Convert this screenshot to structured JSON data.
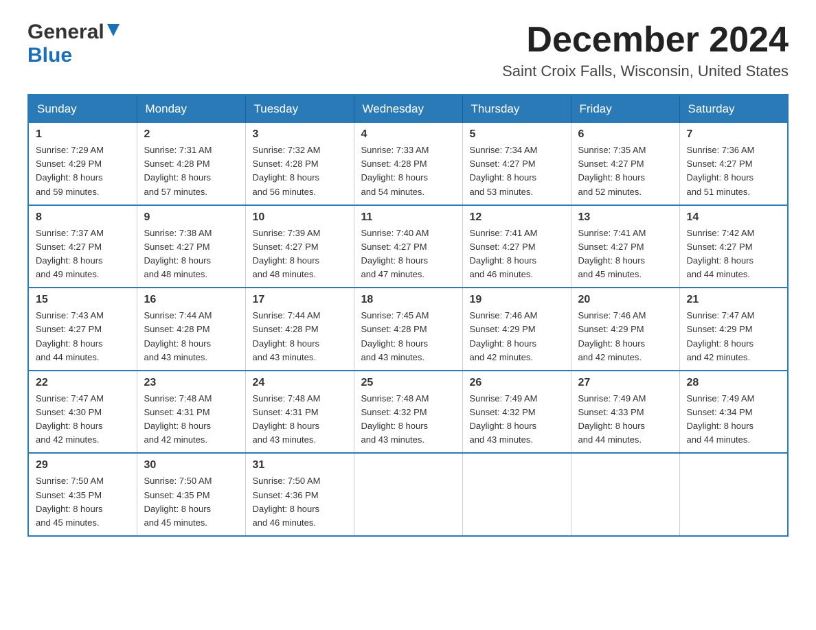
{
  "logo": {
    "general": "General",
    "blue": "Blue"
  },
  "title": {
    "month_year": "December 2024",
    "location": "Saint Croix Falls, Wisconsin, United States"
  },
  "header_days": [
    "Sunday",
    "Monday",
    "Tuesday",
    "Wednesday",
    "Thursday",
    "Friday",
    "Saturday"
  ],
  "weeks": [
    [
      {
        "day": "1",
        "sunrise": "Sunrise: 7:29 AM",
        "sunset": "Sunset: 4:29 PM",
        "daylight": "Daylight: 8 hours",
        "daylight2": "and 59 minutes."
      },
      {
        "day": "2",
        "sunrise": "Sunrise: 7:31 AM",
        "sunset": "Sunset: 4:28 PM",
        "daylight": "Daylight: 8 hours",
        "daylight2": "and 57 minutes."
      },
      {
        "day": "3",
        "sunrise": "Sunrise: 7:32 AM",
        "sunset": "Sunset: 4:28 PM",
        "daylight": "Daylight: 8 hours",
        "daylight2": "and 56 minutes."
      },
      {
        "day": "4",
        "sunrise": "Sunrise: 7:33 AM",
        "sunset": "Sunset: 4:28 PM",
        "daylight": "Daylight: 8 hours",
        "daylight2": "and 54 minutes."
      },
      {
        "day": "5",
        "sunrise": "Sunrise: 7:34 AM",
        "sunset": "Sunset: 4:27 PM",
        "daylight": "Daylight: 8 hours",
        "daylight2": "and 53 minutes."
      },
      {
        "day": "6",
        "sunrise": "Sunrise: 7:35 AM",
        "sunset": "Sunset: 4:27 PM",
        "daylight": "Daylight: 8 hours",
        "daylight2": "and 52 minutes."
      },
      {
        "day": "7",
        "sunrise": "Sunrise: 7:36 AM",
        "sunset": "Sunset: 4:27 PM",
        "daylight": "Daylight: 8 hours",
        "daylight2": "and 51 minutes."
      }
    ],
    [
      {
        "day": "8",
        "sunrise": "Sunrise: 7:37 AM",
        "sunset": "Sunset: 4:27 PM",
        "daylight": "Daylight: 8 hours",
        "daylight2": "and 49 minutes."
      },
      {
        "day": "9",
        "sunrise": "Sunrise: 7:38 AM",
        "sunset": "Sunset: 4:27 PM",
        "daylight": "Daylight: 8 hours",
        "daylight2": "and 48 minutes."
      },
      {
        "day": "10",
        "sunrise": "Sunrise: 7:39 AM",
        "sunset": "Sunset: 4:27 PM",
        "daylight": "Daylight: 8 hours",
        "daylight2": "and 48 minutes."
      },
      {
        "day": "11",
        "sunrise": "Sunrise: 7:40 AM",
        "sunset": "Sunset: 4:27 PM",
        "daylight": "Daylight: 8 hours",
        "daylight2": "and 47 minutes."
      },
      {
        "day": "12",
        "sunrise": "Sunrise: 7:41 AM",
        "sunset": "Sunset: 4:27 PM",
        "daylight": "Daylight: 8 hours",
        "daylight2": "and 46 minutes."
      },
      {
        "day": "13",
        "sunrise": "Sunrise: 7:41 AM",
        "sunset": "Sunset: 4:27 PM",
        "daylight": "Daylight: 8 hours",
        "daylight2": "and 45 minutes."
      },
      {
        "day": "14",
        "sunrise": "Sunrise: 7:42 AM",
        "sunset": "Sunset: 4:27 PM",
        "daylight": "Daylight: 8 hours",
        "daylight2": "and 44 minutes."
      }
    ],
    [
      {
        "day": "15",
        "sunrise": "Sunrise: 7:43 AM",
        "sunset": "Sunset: 4:27 PM",
        "daylight": "Daylight: 8 hours",
        "daylight2": "and 44 minutes."
      },
      {
        "day": "16",
        "sunrise": "Sunrise: 7:44 AM",
        "sunset": "Sunset: 4:28 PM",
        "daylight": "Daylight: 8 hours",
        "daylight2": "and 43 minutes."
      },
      {
        "day": "17",
        "sunrise": "Sunrise: 7:44 AM",
        "sunset": "Sunset: 4:28 PM",
        "daylight": "Daylight: 8 hours",
        "daylight2": "and 43 minutes."
      },
      {
        "day": "18",
        "sunrise": "Sunrise: 7:45 AM",
        "sunset": "Sunset: 4:28 PM",
        "daylight": "Daylight: 8 hours",
        "daylight2": "and 43 minutes."
      },
      {
        "day": "19",
        "sunrise": "Sunrise: 7:46 AM",
        "sunset": "Sunset: 4:29 PM",
        "daylight": "Daylight: 8 hours",
        "daylight2": "and 42 minutes."
      },
      {
        "day": "20",
        "sunrise": "Sunrise: 7:46 AM",
        "sunset": "Sunset: 4:29 PM",
        "daylight": "Daylight: 8 hours",
        "daylight2": "and 42 minutes."
      },
      {
        "day": "21",
        "sunrise": "Sunrise: 7:47 AM",
        "sunset": "Sunset: 4:29 PM",
        "daylight": "Daylight: 8 hours",
        "daylight2": "and 42 minutes."
      }
    ],
    [
      {
        "day": "22",
        "sunrise": "Sunrise: 7:47 AM",
        "sunset": "Sunset: 4:30 PM",
        "daylight": "Daylight: 8 hours",
        "daylight2": "and 42 minutes."
      },
      {
        "day": "23",
        "sunrise": "Sunrise: 7:48 AM",
        "sunset": "Sunset: 4:31 PM",
        "daylight": "Daylight: 8 hours",
        "daylight2": "and 42 minutes."
      },
      {
        "day": "24",
        "sunrise": "Sunrise: 7:48 AM",
        "sunset": "Sunset: 4:31 PM",
        "daylight": "Daylight: 8 hours",
        "daylight2": "and 43 minutes."
      },
      {
        "day": "25",
        "sunrise": "Sunrise: 7:48 AM",
        "sunset": "Sunset: 4:32 PM",
        "daylight": "Daylight: 8 hours",
        "daylight2": "and 43 minutes."
      },
      {
        "day": "26",
        "sunrise": "Sunrise: 7:49 AM",
        "sunset": "Sunset: 4:32 PM",
        "daylight": "Daylight: 8 hours",
        "daylight2": "and 43 minutes."
      },
      {
        "day": "27",
        "sunrise": "Sunrise: 7:49 AM",
        "sunset": "Sunset: 4:33 PM",
        "daylight": "Daylight: 8 hours",
        "daylight2": "and 44 minutes."
      },
      {
        "day": "28",
        "sunrise": "Sunrise: 7:49 AM",
        "sunset": "Sunset: 4:34 PM",
        "daylight": "Daylight: 8 hours",
        "daylight2": "and 44 minutes."
      }
    ],
    [
      {
        "day": "29",
        "sunrise": "Sunrise: 7:50 AM",
        "sunset": "Sunset: 4:35 PM",
        "daylight": "Daylight: 8 hours",
        "daylight2": "and 45 minutes."
      },
      {
        "day": "30",
        "sunrise": "Sunrise: 7:50 AM",
        "sunset": "Sunset: 4:35 PM",
        "daylight": "Daylight: 8 hours",
        "daylight2": "and 45 minutes."
      },
      {
        "day": "31",
        "sunrise": "Sunrise: 7:50 AM",
        "sunset": "Sunset: 4:36 PM",
        "daylight": "Daylight: 8 hours",
        "daylight2": "and 46 minutes."
      },
      {
        "day": "",
        "sunrise": "",
        "sunset": "",
        "daylight": "",
        "daylight2": ""
      },
      {
        "day": "",
        "sunrise": "",
        "sunset": "",
        "daylight": "",
        "daylight2": ""
      },
      {
        "day": "",
        "sunrise": "",
        "sunset": "",
        "daylight": "",
        "daylight2": ""
      },
      {
        "day": "",
        "sunrise": "",
        "sunset": "",
        "daylight": "",
        "daylight2": ""
      }
    ]
  ]
}
